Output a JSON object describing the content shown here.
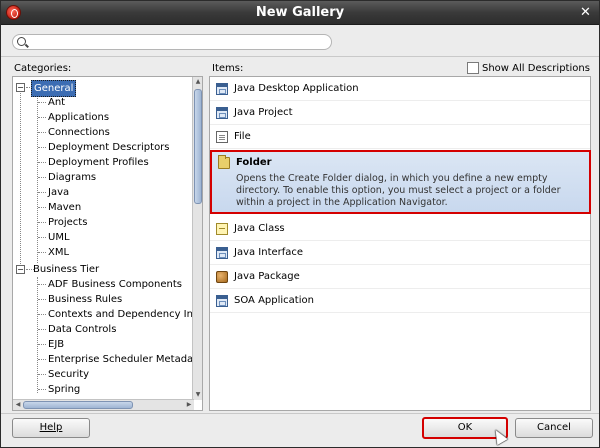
{
  "window": {
    "title": "New Gallery",
    "app_icon": "oracle-icon",
    "close_glyph": "✕"
  },
  "search": {
    "value": "",
    "placeholder": ""
  },
  "categories": {
    "label": "Categories:",
    "groups": [
      {
        "label": "General",
        "expanded": true,
        "selected": true,
        "children": [
          "Ant",
          "Applications",
          "Connections",
          "Deployment Descriptors",
          "Deployment Profiles",
          "Diagrams",
          "Java",
          "Maven",
          "Projects",
          "UML",
          "XML"
        ]
      },
      {
        "label": "Business Tier",
        "expanded": true,
        "selected": false,
        "children": [
          "ADF Business Components",
          "Business Rules",
          "Contexts and Dependency Inj",
          "Data Controls",
          "EJB",
          "Enterprise Scheduler Metadata",
          "Security",
          "Spring"
        ]
      }
    ]
  },
  "items": {
    "label": "Items:",
    "show_all_descriptions": {
      "label": "Show All Descriptions",
      "checked": false
    },
    "list": [
      {
        "label": "Java Desktop Application",
        "icon": "window-icon"
      },
      {
        "label": "Java Project",
        "icon": "window-icon"
      },
      {
        "label": "File",
        "icon": "file-icon"
      },
      {
        "label": "Folder",
        "icon": "folder-icon",
        "selected": true,
        "description": "Opens the Create Folder dialog, in which you define a new empty directory. To enable this option, you must select a project or a folder within a project in the Application Navigator."
      },
      {
        "label": "Java Class",
        "icon": "class-icon"
      },
      {
        "label": "Java Interface",
        "icon": "window-icon"
      },
      {
        "label": "Java Package",
        "icon": "package-icon"
      },
      {
        "label": "SOA Application",
        "icon": "window-icon"
      }
    ]
  },
  "buttons": {
    "help": "Help",
    "ok": "OK",
    "cancel": "Cancel"
  },
  "colors": {
    "selection_highlight": "#d40000",
    "tree_selection": "#3c6db3",
    "title_bar": "#3a3a3a"
  }
}
